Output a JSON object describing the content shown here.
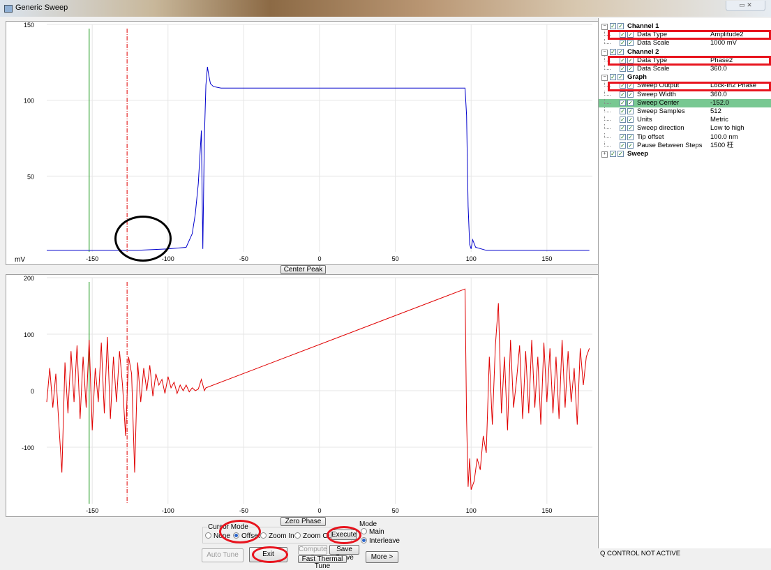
{
  "window": {
    "title": "Generic Sweep"
  },
  "chart_data": [
    {
      "type": "line",
      "ylabel": "mV",
      "xlim": [
        -180,
        180
      ],
      "ylim": [
        0,
        150
      ],
      "x_ticks": [
        -150,
        -100,
        -50,
        0,
        50,
        100,
        150
      ],
      "y_ticks": [
        50,
        100,
        150
      ],
      "grid": true,
      "cursor_green_x": -152,
      "cursor_red_x": -127,
      "series": [
        {
          "color": "#0000cc",
          "x": [
            -180,
            -150,
            -120,
            -100,
            -88,
            -84,
            -82,
            -80,
            -78,
            -77,
            -76,
            -75,
            -74,
            -73,
            -72,
            -70,
            -65,
            -50,
            0,
            50,
            96,
            97,
            98,
            99,
            100,
            101,
            103,
            110,
            150,
            178
          ],
          "y": [
            1,
            1,
            1,
            2,
            3,
            12,
            25,
            45,
            80,
            2,
            75,
            110,
            122,
            116,
            111,
            109,
            108,
            108,
            108,
            108,
            108,
            90,
            30,
            5,
            2,
            8,
            3,
            1,
            1,
            1
          ]
        }
      ]
    },
    {
      "type": "line",
      "xlim": [
        -180,
        180
      ],
      "ylim": [
        -200,
        200
      ],
      "x_ticks": [
        -150,
        -100,
        -50,
        0,
        50,
        100,
        150
      ],
      "y_ticks": [
        -100,
        0,
        100,
        200
      ],
      "grid": true,
      "cursor_green_x": -152,
      "cursor_red_x": -127,
      "series": [
        {
          "color": "#e00000",
          "x": [
            -180,
            -178,
            -176,
            -174,
            -172,
            -170,
            -168,
            -166,
            -164,
            -162,
            -160,
            -158,
            -156,
            -154,
            -152,
            -150,
            -148,
            -146,
            -144,
            -142,
            -140,
            -138,
            -136,
            -134,
            -132,
            -130,
            -128,
            -126,
            -124,
            -122,
            -120,
            -118,
            -116,
            -114,
            -112,
            -110,
            -108,
            -106,
            -104,
            -102,
            -100,
            -98,
            -96,
            -94,
            -92,
            -90,
            -88,
            -86,
            -84,
            -82,
            -80,
            -78,
            -76,
            -75,
            96,
            97,
            98,
            99,
            100,
            102,
            104,
            106,
            108,
            110,
            112,
            114,
            116,
            118,
            120,
            122,
            124,
            126,
            128,
            130,
            132,
            134,
            136,
            138,
            140,
            142,
            144,
            146,
            148,
            150,
            152,
            154,
            156,
            158,
            160,
            162,
            164,
            166,
            168,
            170,
            172,
            174,
            176,
            178
          ],
          "y": [
            -20,
            40,
            -30,
            30,
            -60,
            -145,
            50,
            -40,
            70,
            -20,
            80,
            -50,
            60,
            -30,
            90,
            -70,
            40,
            -20,
            85,
            -40,
            95,
            -50,
            60,
            -20,
            70,
            10,
            -80,
            60,
            30,
            -145,
            50,
            -20,
            40,
            0,
            45,
            -10,
            30,
            10,
            20,
            -5,
            25,
            5,
            15,
            -5,
            10,
            0,
            10,
            -2,
            5,
            0,
            3,
            20,
            0,
            5,
            180,
            -50,
            -170,
            -120,
            -175,
            -160,
            -120,
            -140,
            -80,
            -110,
            60,
            -60,
            80,
            155,
            -40,
            60,
            -70,
            90,
            -30,
            20,
            80,
            -50,
            70,
            -40,
            90,
            -30,
            60,
            -60,
            85,
            -20,
            75,
            -40,
            60,
            -50,
            90,
            -30,
            70,
            -20,
            40,
            -60,
            75,
            10,
            60,
            75
          ]
        }
      ]
    }
  ],
  "buttons": {
    "center_peak": "Center Peak",
    "zero_phase": "Zero Phase",
    "execute": "Execute",
    "compute_q": "Compute Q",
    "save_curve": "Save Curve",
    "auto_tune": "Auto Tune",
    "exit": "Exit",
    "fast_thermal_tune": "Fast Thermal Tune",
    "more": "More >"
  },
  "cursor_mode": {
    "label": "Cursor Mode",
    "options": [
      "None",
      "Offset",
      "Zoom In",
      "Zoom Out"
    ],
    "selected": "Offset"
  },
  "mode": {
    "label": "Mode",
    "options": [
      "Main",
      "Interleave"
    ],
    "selected": "Interleave"
  },
  "tree": [
    {
      "level": 0,
      "expander": "−",
      "label": "Channel 1",
      "bold": true
    },
    {
      "level": 1,
      "label": "Data Type",
      "value": "Amplitude2"
    },
    {
      "level": 1,
      "label": "Data Scale",
      "value": "1000 mV"
    },
    {
      "level": 0,
      "expander": "−",
      "label": "Channel 2",
      "bold": true
    },
    {
      "level": 1,
      "label": "Data Type",
      "value": "Phase2"
    },
    {
      "level": 1,
      "label": "Data Scale",
      "value": "360.0"
    },
    {
      "level": 0,
      "expander": "−",
      "label": "Graph",
      "bold": true
    },
    {
      "level": 1,
      "label": "Sweep Output",
      "value": "Lock-In2 Phase"
    },
    {
      "level": 1,
      "label": "Sweep Width",
      "value": "360.0"
    },
    {
      "level": 1,
      "label": "Sweep Center",
      "value": "-152.0",
      "highlight": true
    },
    {
      "level": 1,
      "label": "Sweep Samples",
      "value": "512"
    },
    {
      "level": 1,
      "label": "Units",
      "value": "Metric"
    },
    {
      "level": 1,
      "label": "Sweep direction",
      "value": "Low to high"
    },
    {
      "level": 1,
      "label": "Tip offset",
      "value": "100.0 nm"
    },
    {
      "level": 1,
      "label": "Pause Between Steps",
      "value": "1500 枉"
    },
    {
      "level": 0,
      "expander": "+",
      "label": "Sweep",
      "bold": true
    }
  ],
  "status": {
    "text": "Q CONTROL NOT ACTIVE"
  },
  "annotation_color": "#e8141e"
}
